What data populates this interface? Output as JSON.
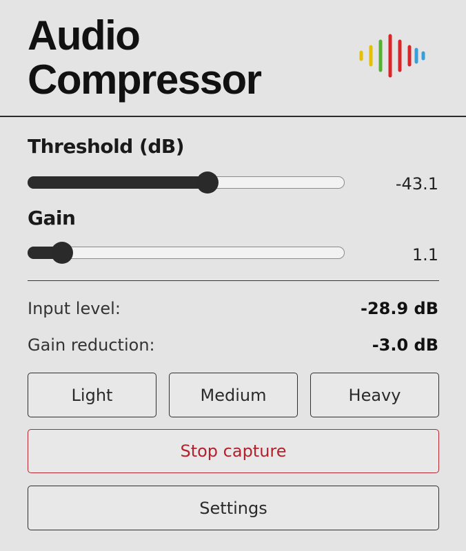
{
  "header": {
    "title_line1": "Audio",
    "title_line2": "Compressor",
    "logo_icon": "audio-waveform-icon",
    "logo_colors": [
      "#e3c100",
      "#e3c100",
      "#55b02f",
      "#d9262b",
      "#d9262b",
      "#d9262b",
      "#3a9fd6",
      "#3a9fd6"
    ]
  },
  "threshold": {
    "label": "Threshold (dB)",
    "value": "-43.1",
    "fill_fraction": 0.57
  },
  "gain": {
    "label": "Gain",
    "value": "1.1",
    "fill_fraction": 0.11
  },
  "stats": {
    "input_level_label": "Input level:",
    "input_level_value": "-28.9 dB",
    "gain_reduction_label": "Gain reduction:",
    "gain_reduction_value": "-3.0 dB"
  },
  "presets": {
    "light": "Light",
    "medium": "Medium",
    "heavy": "Heavy"
  },
  "actions": {
    "stop_capture": "Stop capture",
    "settings": "Settings"
  },
  "colors": {
    "background": "#e4e4e4",
    "stop_accent": "#b4202b",
    "slider_fill": "#2b2b2b"
  }
}
